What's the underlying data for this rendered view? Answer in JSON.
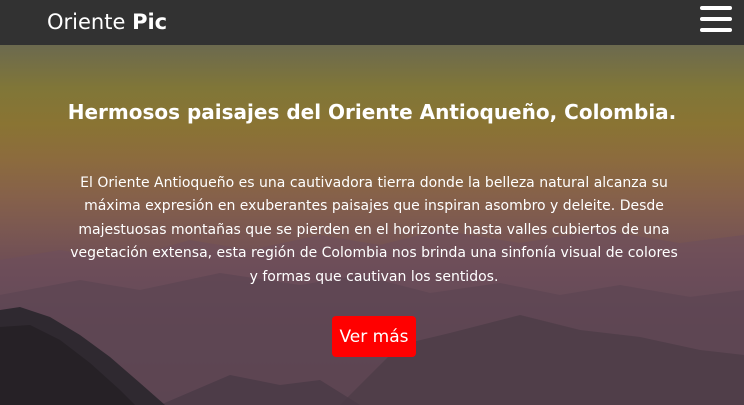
{
  "navbar": {
    "brand_regular": "Oriente ",
    "brand_bold": "Pic",
    "menu_icon": "hamburger-menu-icon"
  },
  "hero": {
    "title": "Hermosos paisajes del Oriente Antioqueño, Colombia.",
    "description": "El Oriente Antioqueño es una cautivadora tierra donde la belleza natural alcanza su máxima expresión en exuberantes paisajes que inspiran asombro y deleite. Desde majestuosas montañas que se pierden en el horizonte hasta valles cubiertos de una vegetación extensa, esta región de Colombia nos brinda una sinfonía visual de colores y formas que cautivan los sentidos.",
    "button_label": "Ver más",
    "button_color": "#ff0000"
  },
  "colors": {
    "navbar_bg": "#323232",
    "text": "#ffffff"
  }
}
